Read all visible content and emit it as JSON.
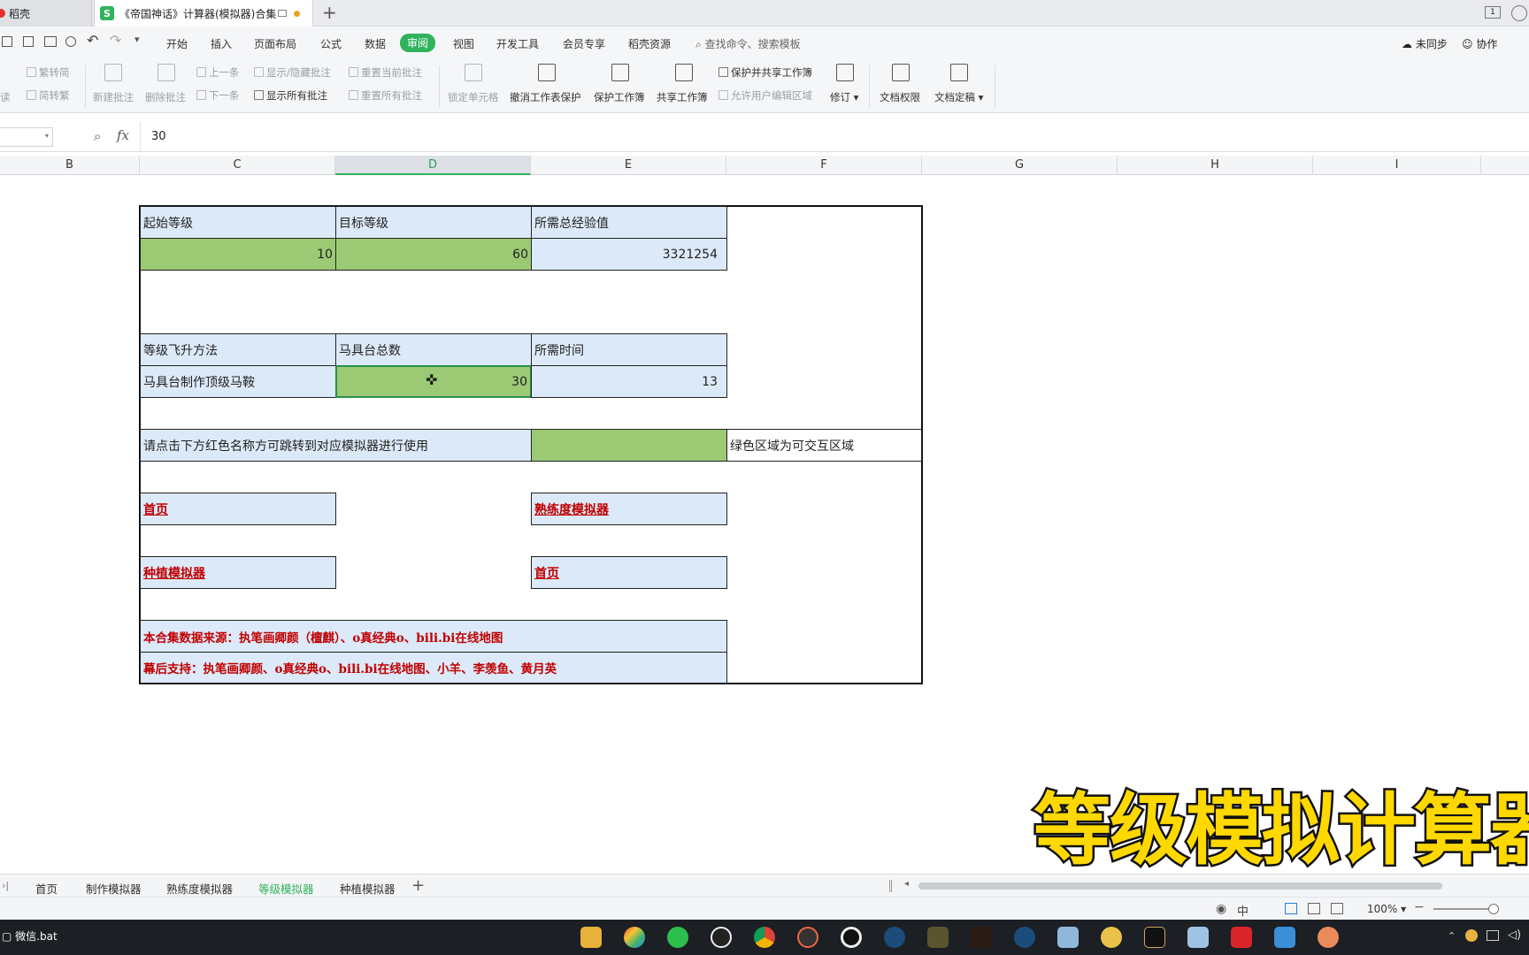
{
  "titlebar": {
    "tab1_label": "稻壳",
    "tab2_label": "《帝国神话》计算器(模拟器)合集",
    "new_tab": "+"
  },
  "menu": {
    "items": [
      "开始",
      "插入",
      "页面布局",
      "公式",
      "数据",
      "审阅",
      "视图",
      "开发工具",
      "会员专享",
      "稻壳资源"
    ],
    "active": "审阅",
    "search_placeholder": "查找命令、搜索模板",
    "unsynced": "未同步",
    "collab": "协作"
  },
  "ribbon": {
    "trad_simp": "繁转简",
    "simp_trad": "简转繁",
    "new_comment": "新建批注",
    "delete_comment": "删除批注",
    "prev": "上一条",
    "next": "下一条",
    "show_hide_comment": "显示/隐藏批注",
    "show_all_comments": "显示所有批注",
    "reset_current": "重置当前批注",
    "reset_all": "重置所有批注",
    "lock_cell": "锁定单元格",
    "unprotect_sheet": "撤消工作表保护",
    "protect_book": "保护工作簿",
    "share_book": "共享工作簿",
    "protect_share": "保护并共享工作簿",
    "allow_edit": "允许用户编辑区域",
    "revise": "修订",
    "doc_perm": "文档权限",
    "doc_final": "文档定稿",
    "left_partial": "读"
  },
  "formula": {
    "fx": "fx",
    "value": "30"
  },
  "columns": [
    "B",
    "C",
    "D",
    "E",
    "F",
    "G",
    "H",
    "I"
  ],
  "selected_column": "D",
  "sheet": {
    "start_level_label": "起始等级",
    "target_level_label": "目标等级",
    "total_exp_label": "所需总经验值",
    "start_level": "10",
    "target_level": "60",
    "total_exp": "3321254",
    "method_label": "等级飞升方法",
    "saddle_table_label": "马具台总数",
    "time_label": "所需时间",
    "method_value": "马具台制作顶级马鞍",
    "saddle_table_count": "30",
    "time_value": "13",
    "instruction": "请点击下方红色名称方可跳转到对应模拟器进行使用",
    "green_hint": "绿色区域为可交互区域",
    "link_home_1": "首页",
    "link_proficiency": "熟练度模拟器",
    "link_planting": "种植模拟器",
    "link_home_2": "首页",
    "credit_source": "本合集数据来源：执笔画卿颜（檀麒）、o真经典o、bili.bi在线地图",
    "credit_support": "幕后支持：执笔画卿颜、o真经典o、bili.bi在线地图、小羊、李羡鱼、黄月英"
  },
  "overlay_title": "等级模拟计算器",
  "sheet_tabs": [
    "首页",
    "制作模拟器",
    "熟练度模拟器",
    "等级模拟器",
    "种植模拟器"
  ],
  "active_sheet_tab": "等级模拟器",
  "status": {
    "ime": "中",
    "zoom": "100%"
  },
  "taskbar": {
    "left_item": "微信.bat"
  },
  "colors": {
    "accent": "#2fb35c",
    "cell_blue": "#dce9f8",
    "cell_green": "#9bc974",
    "link_red": "#c00000",
    "overlay_yellow": "#ffd800"
  }
}
